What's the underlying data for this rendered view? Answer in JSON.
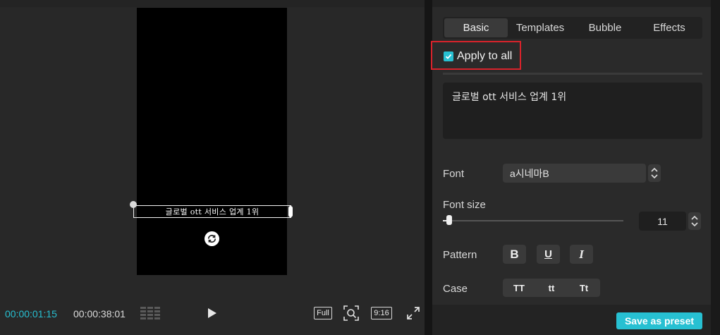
{
  "player": {
    "caption": "글로벌 ott 서비스 업계 1위",
    "time_current": "00:00:01:15",
    "time_total": "00:00:38:01",
    "full_label": "Full",
    "ratio_label": "9:16"
  },
  "panel": {
    "tabs": [
      {
        "label": "Basic",
        "active": true
      },
      {
        "label": "Templates",
        "active": false
      },
      {
        "label": "Bubble",
        "active": false
      },
      {
        "label": "Effects",
        "active": false
      }
    ],
    "apply_to_all": {
      "label": "Apply to all",
      "checked": true
    },
    "text_value": "글로벌 ott 서비스 업계 1위",
    "font": {
      "label": "Font",
      "value": "a시네마B"
    },
    "font_size": {
      "label": "Font size",
      "value": "11",
      "slider_fraction": 0.01
    },
    "pattern": {
      "label": "Pattern",
      "bold": "B",
      "underline": "U",
      "italic": "I"
    },
    "case": {
      "label": "Case",
      "options": [
        "TT",
        "tt",
        "Tt"
      ]
    },
    "save_preset_label": "Save as preset"
  },
  "colors": {
    "accent": "#27c0d2",
    "highlight": "#d9232b"
  }
}
